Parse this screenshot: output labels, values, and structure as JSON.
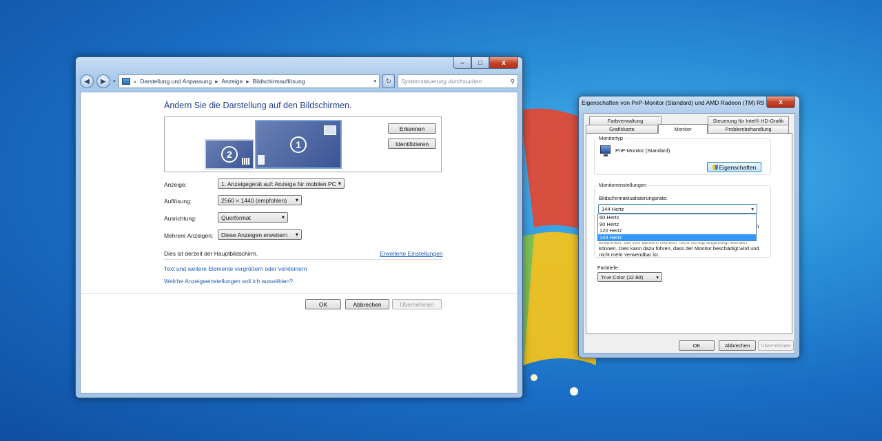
{
  "main_window": {
    "caption_buttons": {
      "minimize": "–",
      "maximize": "□",
      "close": "x"
    },
    "breadcrumb": {
      "prefix": "«",
      "items": [
        "Darstellung und Anpassung",
        "Anzeige",
        "Bildschirmauflösung"
      ],
      "separator": "▸"
    },
    "search": {
      "placeholder": "Systemsteuerung durchsuchen"
    },
    "heading": "Ändern Sie die Darstellung auf den Bildschirmen.",
    "monitors": [
      {
        "number": "1"
      },
      {
        "number": "2"
      }
    ],
    "buttons": {
      "detect": "Erkennen",
      "identify": "Identifizieren",
      "ok": "OK",
      "cancel": "Abbrechen",
      "apply": "Übernehmen"
    },
    "settings": {
      "display_label": "Anzeige:",
      "display_value": "1. Anzeigegerät auf: Anzeige für mobilen PC",
      "resolution_label": "Auflösung:",
      "resolution_value": "2560 × 1440 (empfohlen)",
      "orientation_label": "Ausrichtung:",
      "orientation_value": "Querformat",
      "multi_label": "Mehrere Anzeigen:",
      "multi_value": "Diese Anzeigen erweitern"
    },
    "primary_text": "Dies ist derzeit der Hauptbildschirm.",
    "advanced_link": "Erweiterte Einstellungen",
    "link_text_size": "Text und weitere Elemente vergrößern oder verkleinern",
    "link_which": "Welche Anzeigeeinstellungen soll ich auswählen?"
  },
  "dialog": {
    "title": "Eigenschaften von PnP-Monitor (Standard) und AMD Radeon (TM) R9 3...",
    "close": "x",
    "tabs_top": [
      "Farbverwaltung",
      "Steuerung für Intel® HD-Grafik"
    ],
    "tabs_bottom": [
      "Grafikkarte",
      "Monitor",
      "Problembehandlung"
    ],
    "monitortype_group": "Monitortyp",
    "monitor_name": "PnP-Monitor (Standard)",
    "properties_button": "Eigenschaften",
    "settings_group": "Monitoreinstellungen",
    "refresh_label": "Bildschirmaktualisierungsrate:",
    "refresh_value": "144 Hertz",
    "refresh_options": [
      "60 Hertz",
      "90 Hertz",
      "120 Hertz",
      "144 Hertz"
    ],
    "refresh_selected": "144 Hertz",
    "warning_partial": "Erkennen, die von diesem Monitor nicht richtig angezeigt werden",
    "warning_cut": "n",
    "warning_line2": "können. Dies kann dazu führen, dass der Monitor beschädigt wird und",
    "warning_line3": "nicht mehr verwendbar ist.",
    "depth_label": "Farbtiefe:",
    "depth_value": "True Color (32 Bit)",
    "buttons": {
      "ok": "OK",
      "cancel": "Abbrechen",
      "apply": "Übernehmen"
    }
  }
}
